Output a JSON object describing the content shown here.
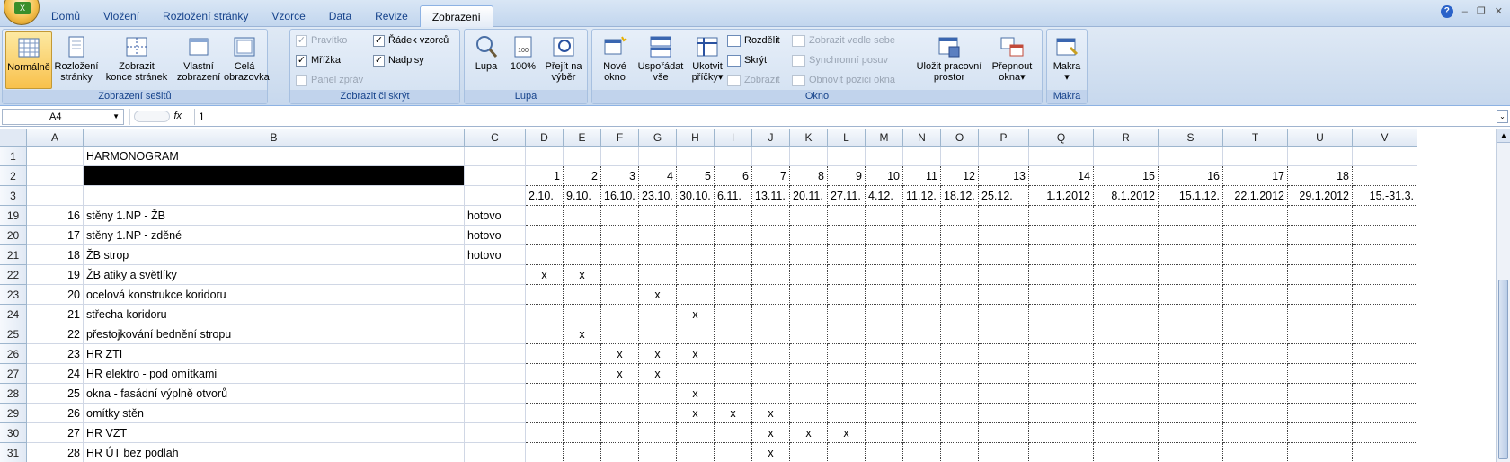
{
  "ribbon_tabs": [
    "Domů",
    "Vložení",
    "Rozložení stránky",
    "Vzorce",
    "Data",
    "Revize",
    "Zobrazení"
  ],
  "active_tab": "Zobrazení",
  "groups": {
    "views": {
      "title": "Zobrazení sešitů",
      "normal": "Normálně",
      "layout1": "Rozložení",
      "layout2": "stránky",
      "pagebreak1": "Zobrazit",
      "pagebreak2": "konce stránek",
      "custom1": "Vlastní",
      "custom2": "zobrazení",
      "full1": "Celá",
      "full2": "obrazovka"
    },
    "show": {
      "title": "Zobrazit či skrýt",
      "ruler": "Pravítko",
      "formula_bar": "Řádek vzorců",
      "gridlines": "Mřížka",
      "headings": "Nadpisy",
      "message_bar": "Panel zpráv"
    },
    "zoom": {
      "title": "Lupa",
      "zoom": "Lupa",
      "zoom100": "100%",
      "selection1": "Přejít na",
      "selection2": "výběr"
    },
    "window": {
      "title": "Okno",
      "new1": "Nové",
      "new2": "okno",
      "arrange1": "Uspořádat",
      "arrange2": "vše",
      "freeze1": "Ukotvit",
      "freeze2": "příčky",
      "split": "Rozdělit",
      "hide": "Skrýt",
      "unhide": "Zobrazit",
      "side": "Zobrazit vedle sebe",
      "sync": "Synchronní posuv",
      "reset": "Obnovit pozici okna",
      "save1": "Uložit pracovní",
      "save2": "prostor",
      "switch1": "Přepnout",
      "switch2": "okna"
    },
    "macros": {
      "title": "Makra",
      "macros": "Makra"
    }
  },
  "name_box": "A4",
  "fx": "fx",
  "formula": "1",
  "columns": [
    "A",
    "B",
    "C",
    "D",
    "E",
    "F",
    "G",
    "H",
    "I",
    "J",
    "K",
    "L",
    "M",
    "N",
    "O",
    "P",
    "Q",
    "R",
    "S",
    "T",
    "U",
    "V"
  ],
  "row_numbers": [
    "1",
    "2",
    "3",
    "19",
    "20",
    "21",
    "22",
    "23",
    "24",
    "25",
    "26",
    "27",
    "28",
    "29",
    "30",
    "31"
  ],
  "title": "HARMONOGRAM",
  "week_numbers": [
    "1",
    "2",
    "3",
    "4",
    "5",
    "6",
    "7",
    "8",
    "9",
    "10",
    "11",
    "12",
    "13",
    "14",
    "15",
    "16",
    "17",
    "18"
  ],
  "week_dates": [
    "2.10.",
    "9.10.",
    "16.10.",
    "23.10.",
    "30.10.",
    "6.11.",
    "13.11.",
    "20.11.",
    "27.11.",
    "4.12.",
    "11.12.",
    "18.12.",
    "25.12.",
    "1.1.2012",
    "8.1.2012",
    "15.1.12.",
    "22.1.2012",
    "29.1.2012",
    "15.-31.3."
  ],
  "rows": [
    {
      "n": "16",
      "task": "stěny 1.NP - ŽB",
      "status": "hotovo",
      "marks": []
    },
    {
      "n": "17",
      "task": "stěny 1.NP - zděné",
      "status": "hotovo",
      "marks": []
    },
    {
      "n": "18",
      "task": "ŽB strop",
      "status": "hotovo",
      "marks": []
    },
    {
      "n": "19",
      "task": "ŽB atiky a světlíky",
      "status": "",
      "marks": [
        "D",
        "E"
      ]
    },
    {
      "n": "20",
      "task": "ocelová konstrukce koridoru",
      "status": "",
      "marks": [
        "G"
      ]
    },
    {
      "n": "21",
      "task": "střecha koridoru",
      "status": "",
      "marks": [
        "H"
      ]
    },
    {
      "n": "22",
      "task": "přestojkování bednění stropu",
      "status": "",
      "marks": [
        "E"
      ]
    },
    {
      "n": "23",
      "task": "HR ZTI",
      "status": "",
      "marks": [
        "F",
        "G",
        "H"
      ]
    },
    {
      "n": "24",
      "task": "HR elektro - pod omítkami",
      "status": "",
      "marks": [
        "F",
        "G"
      ]
    },
    {
      "n": "25",
      "task": "okna - fasádní výplně otvorů",
      "status": "",
      "marks": [
        "H"
      ]
    },
    {
      "n": "26",
      "task": "omítky stěn",
      "status": "",
      "marks": [
        "H",
        "I",
        "J"
      ]
    },
    {
      "n": "27",
      "task": "HR VZT",
      "status": "",
      "marks": [
        "J",
        "K",
        "L"
      ]
    },
    {
      "n": "28",
      "task": "HR ÚT bez podlah",
      "status": "",
      "marks": [
        "J"
      ]
    }
  ],
  "mark_symbol": "x"
}
